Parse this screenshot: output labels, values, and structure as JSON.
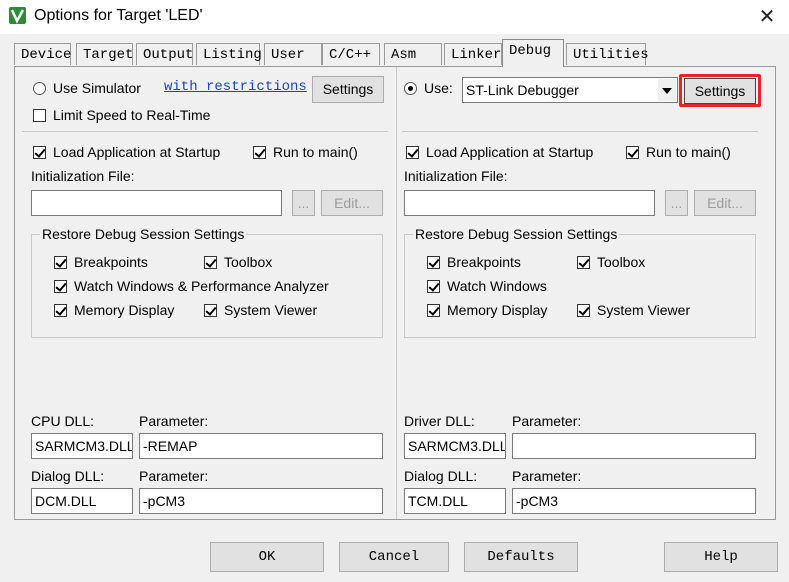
{
  "window": {
    "title": "Options for Target 'LED'",
    "close_glyph": "✕"
  },
  "tabs": [
    {
      "label": "Device"
    },
    {
      "label": "Target"
    },
    {
      "label": "Output"
    },
    {
      "label": "Listing"
    },
    {
      "label": "User"
    },
    {
      "label": "C/C++"
    },
    {
      "label": "Asm"
    },
    {
      "label": "Linker"
    },
    {
      "label": "Debug"
    },
    {
      "label": "Utilities"
    }
  ],
  "active_tab": "Debug",
  "left": {
    "use_simulator_label": "Use Simulator",
    "with_restrictions_link": "with restrictions",
    "settings_label": "Settings",
    "limit_speed_label": "Limit Speed to Real-Time",
    "load_app_label": "Load Application at Startup",
    "run_to_main_label": "Run to main()",
    "init_file_label": "Initialization File:",
    "browse_label": "...",
    "edit_label": "Edit...",
    "restore_group_title": "Restore Debug Session Settings",
    "breakpoints_label": "Breakpoints",
    "toolbox_label": "Toolbox",
    "watch_label": "Watch Windows & Performance Analyzer",
    "memory_label": "Memory Display",
    "system_viewer_label": "System Viewer",
    "cpu_dll_label": "CPU DLL:",
    "cpu_param_label": "Parameter:",
    "cpu_dll_value": "SARMCM3.DLL",
    "cpu_param_value": "-REMAP",
    "dialog_dll_label": "Dialog DLL:",
    "dialog_param_label": "Parameter:",
    "dialog_dll_value": "DCM.DLL",
    "dialog_param_value": "-pCM3"
  },
  "right": {
    "use_label": "Use:",
    "debugger_value": "ST-Link Debugger",
    "settings_label": "Settings",
    "load_app_label": "Load Application at Startup",
    "run_to_main_label": "Run to main()",
    "init_file_label": "Initialization File:",
    "browse_label": "...",
    "edit_label": "Edit...",
    "restore_group_title": "Restore Debug Session Settings",
    "breakpoints_label": "Breakpoints",
    "toolbox_label": "Toolbox",
    "watch_label": "Watch Windows",
    "memory_label": "Memory Display",
    "system_viewer_label": "System Viewer",
    "driver_dll_label": "Driver DLL:",
    "driver_param_label": "Parameter:",
    "driver_dll_value": "SARMCM3.DLL",
    "driver_param_value": "",
    "dialog_dll_label": "Dialog DLL:",
    "dialog_param_label": "Parameter:",
    "dialog_dll_value": "TCM.DLL",
    "dialog_param_value": "-pCM3"
  },
  "buttons": {
    "ok": "OK",
    "cancel": "Cancel",
    "defaults": "Defaults",
    "help": "Help"
  },
  "colors": {
    "highlight": "#e8242a",
    "link": "#1a44c8",
    "app_icon": "#2e8b3a"
  }
}
